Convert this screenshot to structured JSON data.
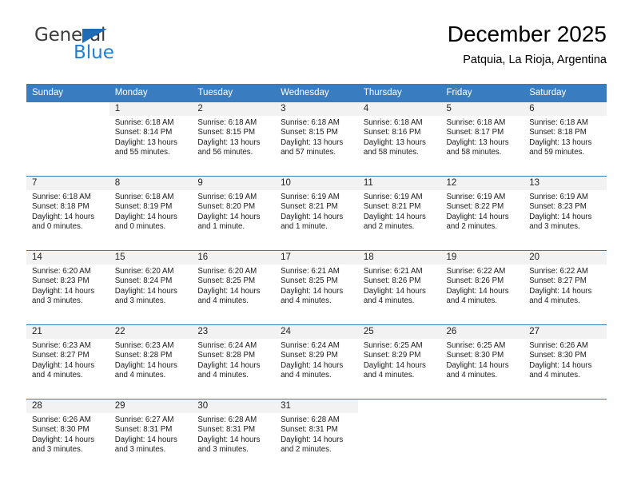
{
  "brand": {
    "name_part1": "General",
    "name_part2": "Blue",
    "flag_icon": "blue-flag-triangle",
    "colors": {
      "dark": "#3c3c3c",
      "blue": "#1f7fd4",
      "flag": "#1f6cb4"
    }
  },
  "header": {
    "title": "December 2025",
    "subtitle": "Patquia, La Rioja, Argentina"
  },
  "theme": {
    "header_bg": "#3a7cc0",
    "daynum_bg": "#f2f2f2",
    "grid_line": "#3a7cc0",
    "text": "#1a1a1a"
  },
  "weekdays": [
    "Sunday",
    "Monday",
    "Tuesday",
    "Wednesday",
    "Thursday",
    "Friday",
    "Saturday"
  ],
  "weeks": [
    [
      {
        "empty": true
      },
      {
        "day": "1",
        "sunrise": "Sunrise: 6:18 AM",
        "sunset": "Sunset: 8:14 PM",
        "daylight": "Daylight: 13 hours and 55 minutes."
      },
      {
        "day": "2",
        "sunrise": "Sunrise: 6:18 AM",
        "sunset": "Sunset: 8:15 PM",
        "daylight": "Daylight: 13 hours and 56 minutes."
      },
      {
        "day": "3",
        "sunrise": "Sunrise: 6:18 AM",
        "sunset": "Sunset: 8:15 PM",
        "daylight": "Daylight: 13 hours and 57 minutes."
      },
      {
        "day": "4",
        "sunrise": "Sunrise: 6:18 AM",
        "sunset": "Sunset: 8:16 PM",
        "daylight": "Daylight: 13 hours and 58 minutes."
      },
      {
        "day": "5",
        "sunrise": "Sunrise: 6:18 AM",
        "sunset": "Sunset: 8:17 PM",
        "daylight": "Daylight: 13 hours and 58 minutes."
      },
      {
        "day": "6",
        "sunrise": "Sunrise: 6:18 AM",
        "sunset": "Sunset: 8:18 PM",
        "daylight": "Daylight: 13 hours and 59 minutes."
      }
    ],
    [
      {
        "day": "7",
        "sunrise": "Sunrise: 6:18 AM",
        "sunset": "Sunset: 8:18 PM",
        "daylight": "Daylight: 14 hours and 0 minutes."
      },
      {
        "day": "8",
        "sunrise": "Sunrise: 6:18 AM",
        "sunset": "Sunset: 8:19 PM",
        "daylight": "Daylight: 14 hours and 0 minutes."
      },
      {
        "day": "9",
        "sunrise": "Sunrise: 6:19 AM",
        "sunset": "Sunset: 8:20 PM",
        "daylight": "Daylight: 14 hours and 1 minute."
      },
      {
        "day": "10",
        "sunrise": "Sunrise: 6:19 AM",
        "sunset": "Sunset: 8:21 PM",
        "daylight": "Daylight: 14 hours and 1 minute."
      },
      {
        "day": "11",
        "sunrise": "Sunrise: 6:19 AM",
        "sunset": "Sunset: 8:21 PM",
        "daylight": "Daylight: 14 hours and 2 minutes."
      },
      {
        "day": "12",
        "sunrise": "Sunrise: 6:19 AM",
        "sunset": "Sunset: 8:22 PM",
        "daylight": "Daylight: 14 hours and 2 minutes."
      },
      {
        "day": "13",
        "sunrise": "Sunrise: 6:19 AM",
        "sunset": "Sunset: 8:23 PM",
        "daylight": "Daylight: 14 hours and 3 minutes."
      }
    ],
    [
      {
        "day": "14",
        "sunrise": "Sunrise: 6:20 AM",
        "sunset": "Sunset: 8:23 PM",
        "daylight": "Daylight: 14 hours and 3 minutes."
      },
      {
        "day": "15",
        "sunrise": "Sunrise: 6:20 AM",
        "sunset": "Sunset: 8:24 PM",
        "daylight": "Daylight: 14 hours and 3 minutes."
      },
      {
        "day": "16",
        "sunrise": "Sunrise: 6:20 AM",
        "sunset": "Sunset: 8:25 PM",
        "daylight": "Daylight: 14 hours and 4 minutes."
      },
      {
        "day": "17",
        "sunrise": "Sunrise: 6:21 AM",
        "sunset": "Sunset: 8:25 PM",
        "daylight": "Daylight: 14 hours and 4 minutes."
      },
      {
        "day": "18",
        "sunrise": "Sunrise: 6:21 AM",
        "sunset": "Sunset: 8:26 PM",
        "daylight": "Daylight: 14 hours and 4 minutes."
      },
      {
        "day": "19",
        "sunrise": "Sunrise: 6:22 AM",
        "sunset": "Sunset: 8:26 PM",
        "daylight": "Daylight: 14 hours and 4 minutes."
      },
      {
        "day": "20",
        "sunrise": "Sunrise: 6:22 AM",
        "sunset": "Sunset: 8:27 PM",
        "daylight": "Daylight: 14 hours and 4 minutes."
      }
    ],
    [
      {
        "day": "21",
        "sunrise": "Sunrise: 6:23 AM",
        "sunset": "Sunset: 8:27 PM",
        "daylight": "Daylight: 14 hours and 4 minutes."
      },
      {
        "day": "22",
        "sunrise": "Sunrise: 6:23 AM",
        "sunset": "Sunset: 8:28 PM",
        "daylight": "Daylight: 14 hours and 4 minutes."
      },
      {
        "day": "23",
        "sunrise": "Sunrise: 6:24 AM",
        "sunset": "Sunset: 8:28 PM",
        "daylight": "Daylight: 14 hours and 4 minutes."
      },
      {
        "day": "24",
        "sunrise": "Sunrise: 6:24 AM",
        "sunset": "Sunset: 8:29 PM",
        "daylight": "Daylight: 14 hours and 4 minutes."
      },
      {
        "day": "25",
        "sunrise": "Sunrise: 6:25 AM",
        "sunset": "Sunset: 8:29 PM",
        "daylight": "Daylight: 14 hours and 4 minutes."
      },
      {
        "day": "26",
        "sunrise": "Sunrise: 6:25 AM",
        "sunset": "Sunset: 8:30 PM",
        "daylight": "Daylight: 14 hours and 4 minutes."
      },
      {
        "day": "27",
        "sunrise": "Sunrise: 6:26 AM",
        "sunset": "Sunset: 8:30 PM",
        "daylight": "Daylight: 14 hours and 4 minutes."
      }
    ],
    [
      {
        "day": "28",
        "sunrise": "Sunrise: 6:26 AM",
        "sunset": "Sunset: 8:30 PM",
        "daylight": "Daylight: 14 hours and 3 minutes."
      },
      {
        "day": "29",
        "sunrise": "Sunrise: 6:27 AM",
        "sunset": "Sunset: 8:31 PM",
        "daylight": "Daylight: 14 hours and 3 minutes."
      },
      {
        "day": "30",
        "sunrise": "Sunrise: 6:28 AM",
        "sunset": "Sunset: 8:31 PM",
        "daylight": "Daylight: 14 hours and 3 minutes."
      },
      {
        "day": "31",
        "sunrise": "Sunrise: 6:28 AM",
        "sunset": "Sunset: 8:31 PM",
        "daylight": "Daylight: 14 hours and 2 minutes."
      },
      {
        "empty": true
      },
      {
        "empty": true
      },
      {
        "empty": true
      }
    ]
  ]
}
